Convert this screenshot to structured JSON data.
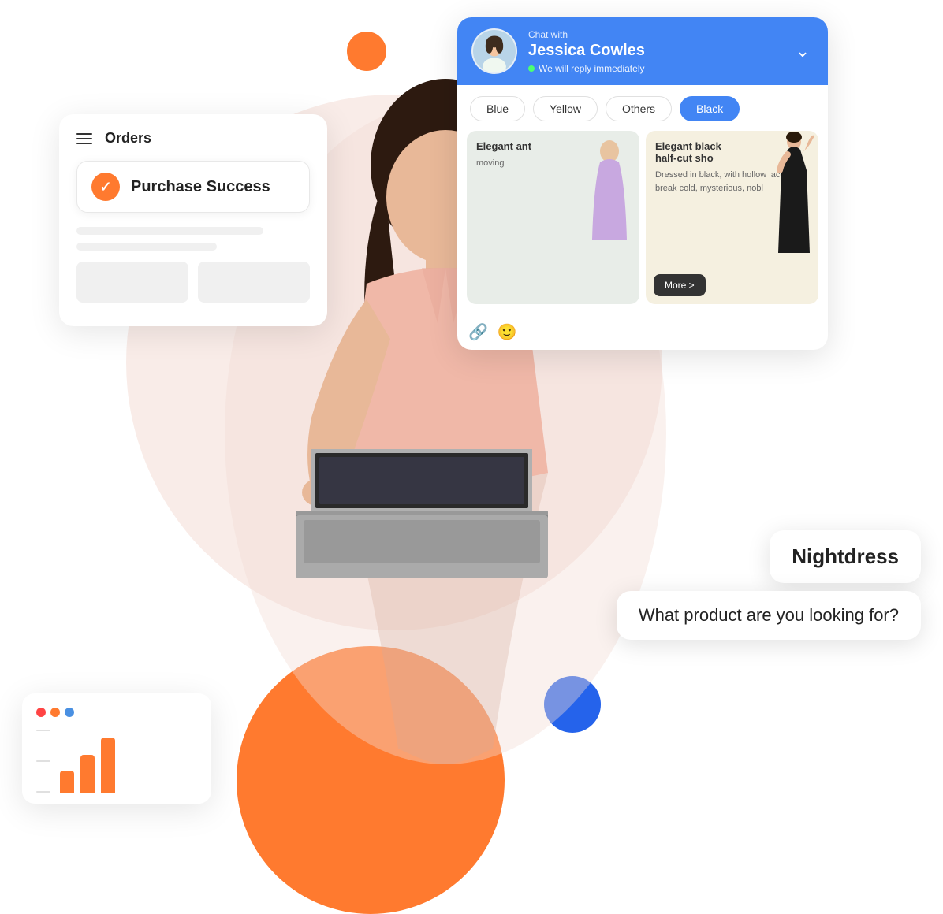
{
  "page": {
    "bg_circle_color": "#f9ece8",
    "orange_dot_color": "#ff7a2f",
    "blue_dot_color": "#2563eb"
  },
  "orders_panel": {
    "title": "Orders",
    "purchase_success_label": "Purchase Success",
    "check_label": "✓"
  },
  "analytics_panel": {
    "dots": [
      "red",
      "orange",
      "blue"
    ],
    "bars": [
      28,
      48,
      70
    ]
  },
  "chat": {
    "header": {
      "chat_with_label": "Chat with",
      "agent_name": "Jessica Cowles",
      "status_text": "We will reply immediately",
      "chevron_label": "▾"
    },
    "color_filters": {
      "pills": [
        {
          "label": "Blue",
          "active": false
        },
        {
          "label": "Yellow",
          "active": false
        },
        {
          "label": "Others",
          "active": false
        },
        {
          "label": "Black",
          "active": true
        }
      ]
    },
    "products": [
      {
        "title": "Elegant ant",
        "desc": "moving",
        "more_label": ""
      },
      {
        "title": "Elegant black half-cut sho",
        "desc": "Dressed in black, with hollow lace skirt, break cold, mysterious, nobl",
        "more_label": "More >"
      }
    ],
    "input_icons": [
      "attach-icon",
      "emoji-icon"
    ]
  },
  "nightdress_bubble": {
    "text": "Nightdress"
  },
  "question_bubble": {
    "text": "What product are you looking for?"
  }
}
